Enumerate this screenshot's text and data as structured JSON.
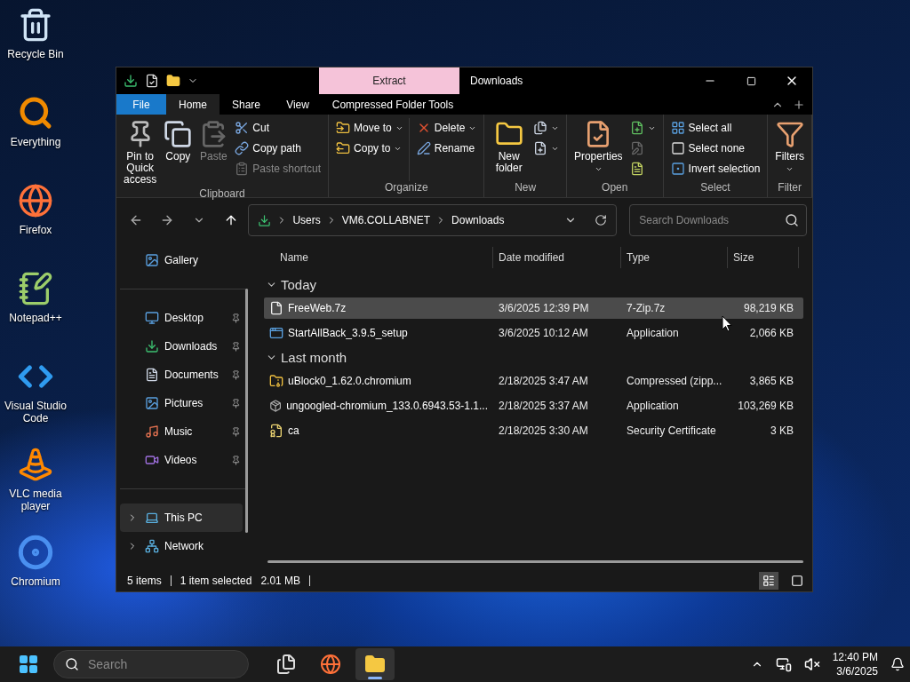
{
  "desktop_icons": [
    {
      "label": "Recycle Bin"
    },
    {
      "label": "Everything"
    },
    {
      "label": "Firefox"
    },
    {
      "label": "Notepad++"
    },
    {
      "label": "Visual Studio Code"
    },
    {
      "label": "VLC media player"
    },
    {
      "label": "Chromium"
    }
  ],
  "window": {
    "title": "Downloads",
    "contextual_tab": "Extract",
    "ribbon_tabs": [
      {
        "label": "File",
        "kind": "file",
        "selected": false
      },
      {
        "label": "Home",
        "kind": "tab",
        "selected": true
      },
      {
        "label": "Share",
        "kind": "tab",
        "selected": false
      },
      {
        "label": "View",
        "kind": "tab",
        "selected": false
      },
      {
        "label": "Compressed Folder Tools",
        "kind": "contextual",
        "selected": false
      }
    ],
    "ribbon_groups": [
      {
        "label": "Clipboard",
        "columns": [
          [
            {
              "label": "Pin to Quick access",
              "kind": "large",
              "disabled": false,
              "dropdown": false
            }
          ],
          [
            {
              "label": "Copy",
              "kind": "large",
              "disabled": false,
              "dropdown": false
            }
          ],
          [
            {
              "label": "Paste",
              "kind": "large",
              "disabled": true,
              "dropdown": false
            }
          ],
          [
            {
              "label": "Cut",
              "kind": "small",
              "disabled": false,
              "dropdown": false
            },
            {
              "label": "Copy path",
              "kind": "small",
              "disabled": false,
              "dropdown": false
            },
            {
              "label": "Paste shortcut",
              "kind": "small",
              "disabled": true,
              "dropdown": false
            }
          ]
        ]
      },
      {
        "label": "Organize",
        "columns": [
          [
            {
              "label": "Move to",
              "kind": "small",
              "disabled": false,
              "dropdown": true
            },
            {
              "label": "Copy to",
              "kind": "small",
              "disabled": false,
              "dropdown": true
            }
          ],
          [
            {
              "label": "Delete",
              "kind": "small",
              "disabled": false,
              "dropdown": true
            },
            {
              "label": "Rename",
              "kind": "small",
              "disabled": false,
              "dropdown": false
            }
          ]
        ]
      },
      {
        "label": "New",
        "columns": [
          [
            {
              "label": "New folder",
              "kind": "large",
              "disabled": false,
              "dropdown": false
            }
          ],
          [
            {
              "kind": "icon",
              "disabled": false,
              "dropdown": true
            },
            {
              "kind": "icon",
              "disabled": false,
              "dropdown": true
            }
          ]
        ]
      },
      {
        "label": "Open",
        "columns": [
          [
            {
              "label": "Properties",
              "kind": "large",
              "disabled": false,
              "dropdown": true
            }
          ],
          [
            {
              "kind": "icon",
              "disabled": false,
              "dropdown": true
            },
            {
              "kind": "icon",
              "disabled": true,
              "dropdown": false
            },
            {
              "kind": "icon",
              "disabled": false,
              "dropdown": false
            }
          ]
        ]
      },
      {
        "label": "Select",
        "columns": [
          [
            {
              "label": "Select all",
              "kind": "small",
              "disabled": false,
              "dropdown": false
            },
            {
              "label": "Select none",
              "kind": "small",
              "disabled": false,
              "dropdown": false
            },
            {
              "label": "Invert selection",
              "kind": "small",
              "disabled": false,
              "dropdown": false
            }
          ]
        ]
      },
      {
        "label": "Filter",
        "columns": [
          [
            {
              "label": "Filters",
              "kind": "large",
              "disabled": false,
              "dropdown": true
            }
          ]
        ]
      }
    ],
    "address": {
      "crumbs": [
        "Users",
        "VM6.COLLABNET",
        "Downloads"
      ]
    },
    "search": {
      "placeholder": "Search Downloads"
    },
    "nav_pane": {
      "sections": [
        {
          "items": [
            {
              "label": "Gallery",
              "kind": "gallery",
              "pinned": false,
              "expandable": false,
              "selected": false
            }
          ]
        },
        {
          "items": [
            {
              "label": "Desktop",
              "kind": "desktop",
              "pinned": true,
              "expandable": false,
              "selected": false
            },
            {
              "label": "Downloads",
              "kind": "downloads",
              "pinned": true,
              "expandable": false,
              "selected": false
            },
            {
              "label": "Documents",
              "kind": "documents",
              "pinned": true,
              "expandable": false,
              "selected": false
            },
            {
              "label": "Pictures",
              "kind": "pictures",
              "pinned": true,
              "expandable": false,
              "selected": false
            },
            {
              "label": "Music",
              "kind": "music",
              "pinned": true,
              "expandable": false,
              "selected": false
            },
            {
              "label": "Videos",
              "kind": "videos",
              "pinned": true,
              "expandable": false,
              "selected": false
            }
          ]
        },
        {
          "items": [
            {
              "label": "This PC",
              "kind": "pc",
              "pinned": false,
              "expandable": true,
              "selected": true
            },
            {
              "label": "Network",
              "kind": "network",
              "pinned": false,
              "expandable": true,
              "selected": false
            }
          ]
        }
      ]
    },
    "columns": [
      "Name",
      "Date modified",
      "Type",
      "Size"
    ],
    "groups": [
      {
        "label": "Today",
        "expanded": true,
        "rows": [
          {
            "name": "FreeWeb.7z",
            "kind": "file",
            "date": "3/6/2025 12:39 PM",
            "type": "7-Zip.7z",
            "size": "98,219 KB",
            "selected": true
          },
          {
            "name": "StartAllBack_3.9.5_setup",
            "kind": "app",
            "date": "3/6/2025 10:12 AM",
            "type": "Application",
            "size": "2,066 KB",
            "selected": false
          }
        ]
      },
      {
        "label": "Last month",
        "expanded": true,
        "rows": [
          {
            "name": "uBlock0_1.62.0.chromium",
            "kind": "zip",
            "date": "2/18/2025 3:47 AM",
            "type": "Compressed (zipp...",
            "size": "3,865 KB",
            "selected": false
          },
          {
            "name": "ungoogled-chromium_133.0.6943.53-1.1...",
            "kind": "installer",
            "date": "2/18/2025 3:37 AM",
            "type": "Application",
            "size": "103,269 KB",
            "selected": false
          },
          {
            "name": "ca",
            "kind": "certificate",
            "date": "2/18/2025 3:30 AM",
            "type": "Security Certificate",
            "size": "3 KB",
            "selected": false
          }
        ]
      }
    ],
    "status_bar": {
      "item_count": "5 items",
      "selection": "1 item selected",
      "selection_size": "2.01 MB",
      "views": [
        {
          "selected": true
        },
        {
          "selected": false
        }
      ]
    }
  },
  "taskbar": {
    "search": {
      "placeholder": "Search"
    },
    "apps": [
      {
        "selected": false
      },
      {
        "selected": false
      },
      {
        "selected": true
      }
    ],
    "time": "12:40 PM",
    "date": "3/6/2025"
  }
}
